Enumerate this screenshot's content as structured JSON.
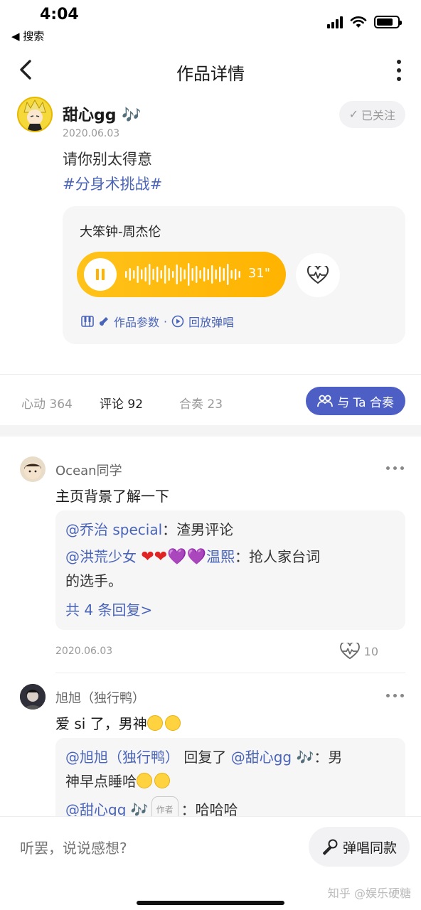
{
  "status_bar": {
    "time": "4:04",
    "back_label": "◀ 搜索"
  },
  "nav": {
    "title": "作品详情"
  },
  "post": {
    "author_name": "甜心gg 🎶",
    "date": "2020.06.03",
    "follow_label": "已关注",
    "text": "请你别太得意",
    "tag": "#分身术挑战#"
  },
  "music": {
    "song": "大笨钟-周杰伦",
    "duration": "31\"",
    "links": {
      "params": "作品参数",
      "sep": "·",
      "replay": "回放弹唱"
    }
  },
  "stats": {
    "likes": "心动 364",
    "comments": "评论 92",
    "duets": "合奏 23",
    "duet_button": "与 Ta 合奏"
  },
  "comments": [
    {
      "user": "Ocean同学",
      "text": "主页背景了解一下",
      "replies": [
        {
          "mention": "@乔治 special",
          "colon": "：",
          "text": "渣男评论"
        },
        {
          "mention": "@洪荒少女",
          "emoji": [
            "❤",
            "❤",
            "💜",
            "💜"
          ],
          "name_tail": "温熙",
          "colon": "：",
          "text": "抢人家台词",
          "text2": "的选手。"
        }
      ],
      "reply_count": "共 4 条回复>",
      "date": "2020.06.03",
      "likes": "10"
    },
    {
      "user": "旭旭（独行鸭）",
      "text": "爱 si 了，男神",
      "replies": [
        {
          "mention": "@旭旭（独行鸭）",
          "mid": "回复了",
          "mention2": "@甜心gg 🎶",
          "colon": "：",
          "text": "男",
          "text2": "神早点睡哈"
        },
        {
          "mention": "@甜心gg 🎶",
          "author_tag": "作者",
          "colon": "：",
          "text": "哈哈哈"
        }
      ]
    }
  ],
  "bottom": {
    "placeholder": "听罢，说说感想?",
    "sing_button": "弹唱同款",
    "watermark": "知乎 @娱乐硬糖"
  },
  "colors": {
    "accent": "#4d5fc5",
    "player": "#ffb300",
    "link": "#4a64b8"
  }
}
